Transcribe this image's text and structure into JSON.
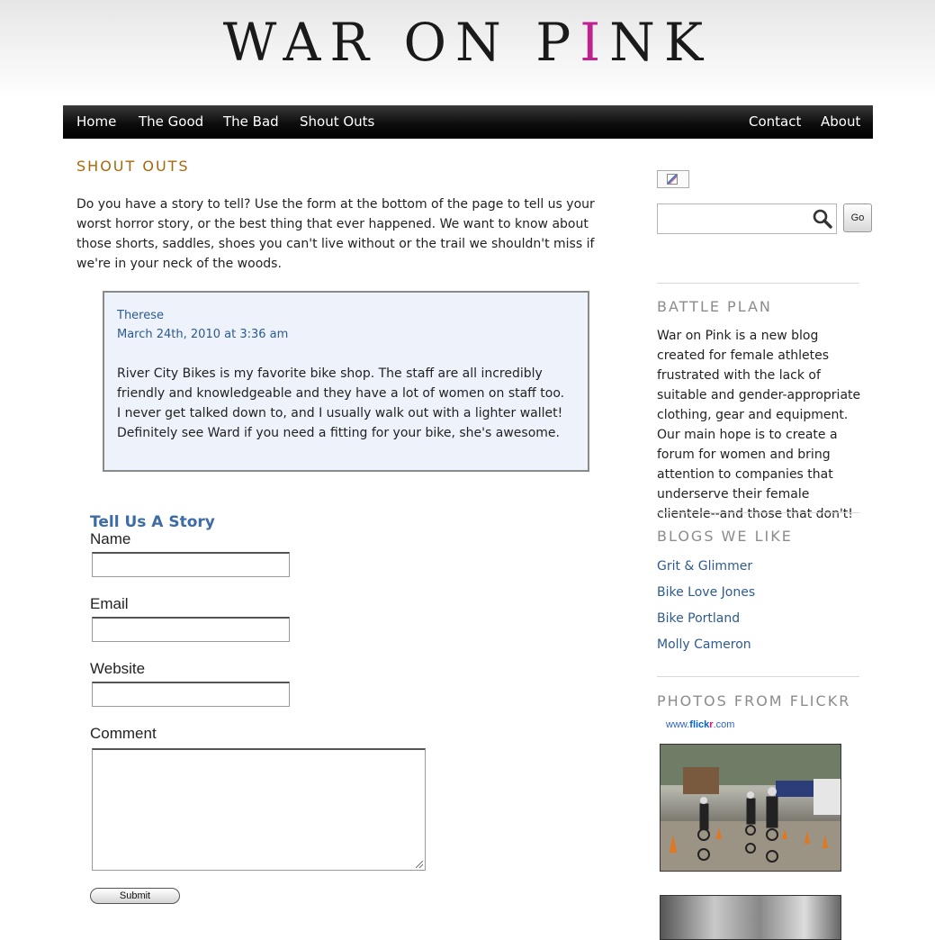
{
  "site": {
    "logo_pre": "WAR ON P",
    "logo_i": "I",
    "logo_post": "NK"
  },
  "nav": {
    "left": [
      "Home",
      "The Good",
      "The Bad",
      "Shout Outs"
    ],
    "right": [
      "Contact",
      "About"
    ]
  },
  "main": {
    "title": "SHOUT OUTS",
    "intro": "Do you have a story to tell? Use the form at the bottom of the page to tell us your worst horror story, or the best thing that ever happened. We want to know about those shorts, saddles, shoes you can't live without or the trail we shouldn't miss if we're in your neck of the woods.",
    "comment": {
      "author": "Therese",
      "date": "March 24th, 2010 at 3:36 am",
      "text": "River City Bikes is my favorite bike shop. The staff are all incredibly friendly and knowledgeable and they have a lot of women on staff too. I never get talked down to, and I usually walk out with a lighter wallet! Definitely see Ward if you need a fitting for your bike, she's awesome."
    },
    "form": {
      "title": "Tell Us A Story",
      "name_label": "Name",
      "name_value": "",
      "email_label": "Email",
      "email_value": "",
      "website_label": "Website",
      "website_value": "",
      "comment_label": "Comment",
      "comment_value": "",
      "submit_label": "Submit"
    }
  },
  "sidebar": {
    "search_value": "",
    "go_label": "Go",
    "battle_title": "BATTLE PLAN",
    "battle_text": "War on Pink is a new blog created for female athletes frustrated with the lack of suitable and gender-appropriate clothing, gear and equipment. Our main hope is to create a forum for women and bring attention to companies that underserve their female clientele--and those that don't!",
    "blogs_title": "BLOGS WE LIKE",
    "blogs": [
      "Grit & Glimmer",
      "Bike Love Jones",
      "Bike Portland",
      "Molly Cameron"
    ],
    "flickr_title": "PHOTOS FROM FLICKR",
    "flickr_logo": {
      "pre": "www.",
      "flick": "flick",
      "r": "r",
      "post": ".com"
    }
  },
  "colors": {
    "accent_pink": "#c0218f",
    "title_orange": "#a8670b",
    "link_blue": "#2d5b8f",
    "comment_bg": "#edf2fb"
  }
}
